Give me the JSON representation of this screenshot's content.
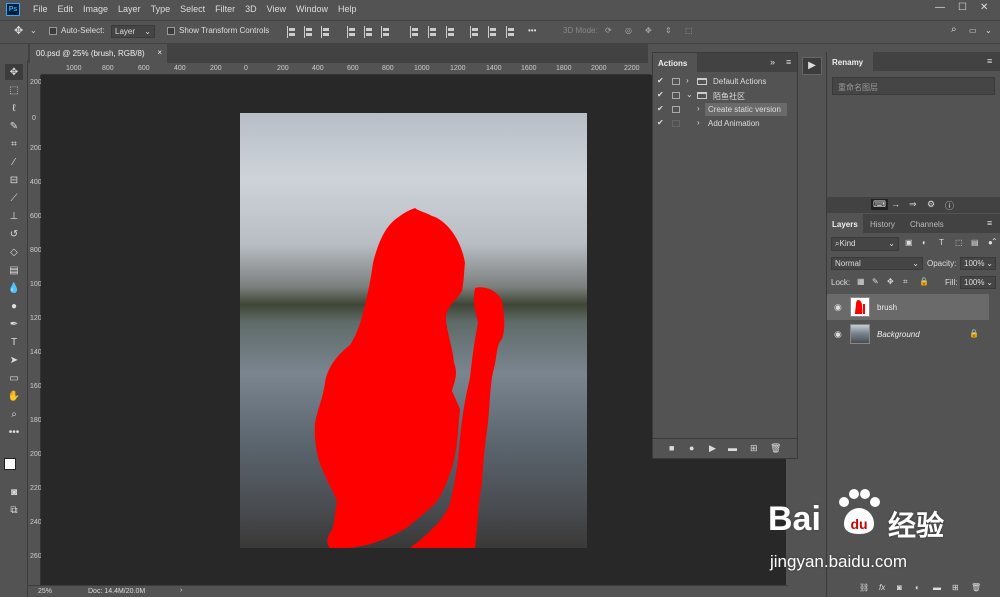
{
  "app": {
    "logo": "Ps"
  },
  "menu": [
    "File",
    "Edit",
    "Image",
    "Layer",
    "Type",
    "Select",
    "Filter",
    "3D",
    "View",
    "Window",
    "Help"
  ],
  "window_controls": {
    "minimize": "—",
    "maximize": "☐",
    "close": "✕"
  },
  "options_bar": {
    "auto_select_label": "Auto-Select:",
    "auto_select_value": "Layer",
    "show_transform_label": "Show Transform Controls",
    "mode_label": "3D Mode:"
  },
  "document": {
    "tab_title": "00.psd @ 25% (brush, RGB/8)",
    "close": "×",
    "ruler_h": [
      "1000",
      "800",
      "600",
      "400",
      "200",
      "0",
      "200",
      "400",
      "600",
      "800",
      "1000",
      "1200",
      "1400",
      "1600",
      "1800",
      "2000",
      "2200"
    ],
    "ruler_v": [
      "200",
      "0",
      "200",
      "400",
      "600",
      "800",
      "1000",
      "1200",
      "1400",
      "1600",
      "1800",
      "2000",
      "2200",
      "2400",
      "2600",
      "2800",
      "3000"
    ]
  },
  "status": {
    "zoom": "25%",
    "doc": "Doc: 14.4M/20.0M",
    "arrow": "›"
  },
  "actions_panel": {
    "title": "Actions",
    "items": [
      {
        "check": "✔",
        "expand": "›",
        "label": "Default Actions",
        "folder": true
      },
      {
        "check": "✔",
        "expand": "⌄",
        "label": "陌鱼社区",
        "folder": true
      },
      {
        "check": "✔",
        "expand": "›",
        "label": "Create static version",
        "folder": false,
        "selected": true
      },
      {
        "check": "✔",
        "expand": "›",
        "label": "Add Animation",
        "folder": false
      }
    ]
  },
  "renamy_panel": {
    "title": "Renamy",
    "placeholder": "重命名图层"
  },
  "layers_panel": {
    "tabs": [
      "Layers",
      "History",
      "Channels"
    ],
    "filter_kind": "Kind",
    "blend_mode": "Normal",
    "opacity_label": "Opacity:",
    "opacity_value": "100%",
    "lock_label": "Lock:",
    "fill_label": "Fill:",
    "fill_value": "100%",
    "layers": [
      {
        "name": "brush",
        "italic": false,
        "selected": true
      },
      {
        "name": "Background",
        "italic": true,
        "locked": true
      }
    ],
    "footer_fx": "fx"
  },
  "watermark": {
    "brand": "Bai",
    "brand2": "经验",
    "url": "jingyan.baidu.com"
  },
  "colors": {
    "accent_red": "#ff0000",
    "panel": "#535353",
    "dark": "#424242",
    "canvas": "#282828"
  }
}
